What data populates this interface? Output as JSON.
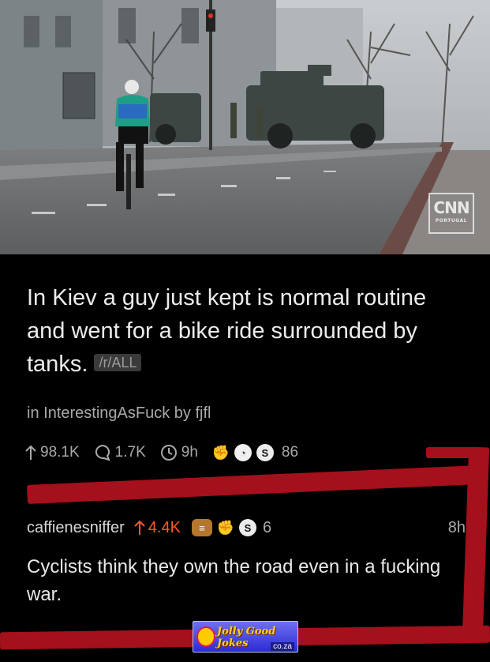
{
  "photo": {
    "alt": "",
    "watermark_logo": "CNN",
    "watermark_sub": "PORTUGAL"
  },
  "post": {
    "title": "In Kiev a guy just kept is normal routine and went for a bike ride surrounded by tanks.",
    "flair": "/r/ALL",
    "subreddit_prefix": "in",
    "subreddit": "InterestingAsFuck",
    "by_label": "by",
    "author": "fjfl",
    "upvotes": "98.1K",
    "comments": "1.7K",
    "age": "9h",
    "awards_count": "86"
  },
  "comment": {
    "user": "caffienesniffer",
    "score": "4.4K",
    "awards_count": "6",
    "age": "8h",
    "body": "Cyclists think they own the road even in a fucking war."
  },
  "watermark": {
    "name": "Jolly Good Jokes",
    "domain": "co.za"
  },
  "colors": {
    "background": "#000000",
    "upvote_comment": "#ff5a1f",
    "marker": "#a4101b"
  }
}
